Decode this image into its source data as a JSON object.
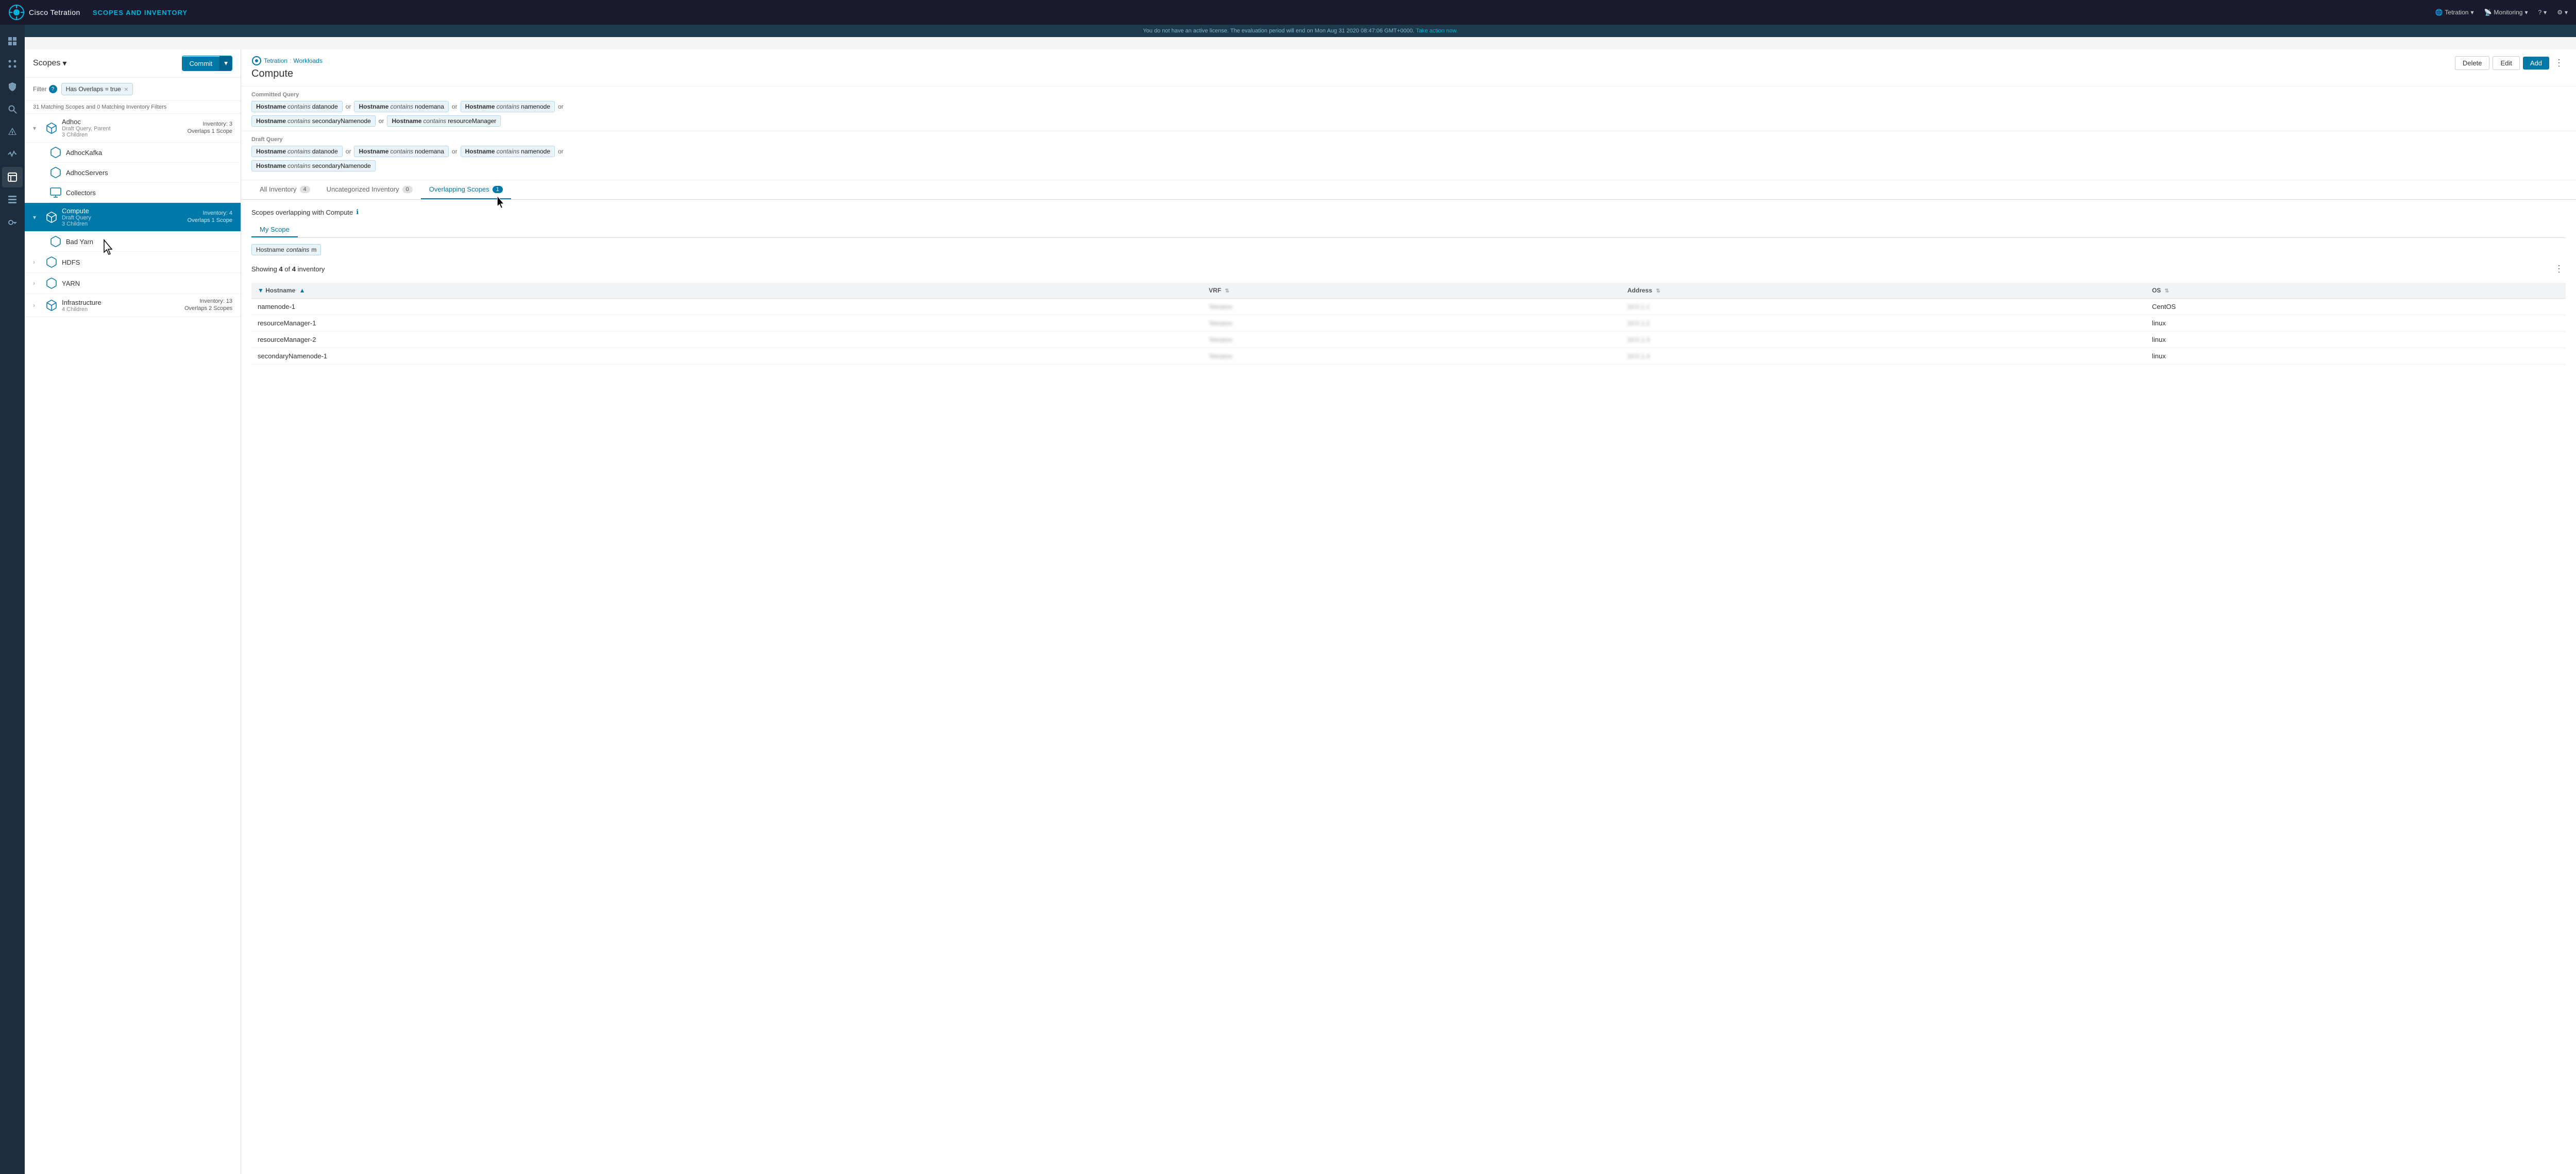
{
  "app": {
    "logo_text": "Cisco Tetration",
    "page_title": "SCOPES AND INVENTORY"
  },
  "top_nav": {
    "right_items": [
      {
        "label": "Tetration",
        "icon": "globe-icon",
        "has_dropdown": true
      },
      {
        "label": "Monitoring",
        "icon": "monitor-icon",
        "has_dropdown": true
      },
      {
        "label": "?",
        "icon": "help-icon",
        "has_dropdown": true
      },
      {
        "label": "⚙",
        "icon": "settings-icon",
        "has_dropdown": true
      }
    ]
  },
  "license_bar": {
    "text": "You do not have an active license. The evaluation period will end on Mon Aug 31 2020 08:47:06 GMT+0000.",
    "link_text": "Take action now."
  },
  "sidebar_icons": [
    {
      "icon": "chart-icon",
      "name": "dashboard"
    },
    {
      "icon": "grid-icon",
      "name": "apps"
    },
    {
      "icon": "shield-icon",
      "name": "security"
    },
    {
      "icon": "search-icon",
      "name": "search"
    },
    {
      "icon": "bell-icon",
      "name": "alerts"
    },
    {
      "icon": "activity-icon",
      "name": "activity"
    },
    {
      "icon": "layers-icon",
      "name": "scopes"
    },
    {
      "icon": "list-icon",
      "name": "inventory"
    },
    {
      "icon": "key-icon",
      "name": "keys"
    }
  ],
  "scopes_panel": {
    "title": "Scopes",
    "commit_button": "Commit",
    "filter_label": "Filter",
    "filter_tag": "Has Overlaps = true",
    "matching_text": "31 Matching Scopes and 0 Matching Inventory Filters",
    "items": [
      {
        "name": "Adhoc",
        "subtitle": "Draft Query, Parent",
        "children_count": "3 Children",
        "inventory": "Inventory: 3",
        "overlaps": "Overlaps 1 Scope",
        "expanded": true,
        "children": [
          {
            "name": "AdhocKafka",
            "has_icon": true
          },
          {
            "name": "AdhocServers",
            "has_icon": true
          },
          {
            "name": "Collectors",
            "has_icon": true
          }
        ]
      },
      {
        "name": "Compute",
        "subtitle": "Draft Query",
        "children_count": "3 Children",
        "inventory": "Inventory: 4",
        "overlaps": "Overlaps 1 Scope",
        "active": true,
        "expanded": true,
        "children": [
          {
            "name": "Bad Yarn",
            "has_icon": true
          }
        ]
      },
      {
        "name": "HDFS",
        "subtitle": "",
        "children_count": "",
        "inventory": "",
        "overlaps": "",
        "has_expand": true
      },
      {
        "name": "YARN",
        "subtitle": "",
        "children_count": "",
        "inventory": "",
        "overlaps": "",
        "has_expand": true
      },
      {
        "name": "Infrastructure",
        "subtitle": "",
        "children_count": "4 Children",
        "inventory": "Inventory: 13",
        "overlaps": "Overlaps 2 Scopes",
        "has_expand": true
      }
    ]
  },
  "content": {
    "breadcrumb_root": "Tetration",
    "breadcrumb_sep": ":",
    "breadcrumb_child": "Workloads",
    "scope_name": "Compute",
    "committed_query_label": "Committed Query",
    "committed_query": [
      [
        {
          "attr": "Hostname",
          "op": "contains",
          "val": "datanode"
        },
        "or",
        {
          "attr": "Hostname",
          "op": "contains",
          "val": "nodemana"
        },
        "or",
        {
          "attr": "Hostname",
          "op": "contains",
          "val": "namenode"
        },
        "or"
      ],
      [
        {
          "attr": "Hostname",
          "op": "contains",
          "val": "secondaryNamenode"
        },
        "or",
        {
          "attr": "Hostname",
          "op": "contains",
          "val": "resourceManager"
        }
      ]
    ],
    "draft_query_label": "Draft Query",
    "draft_query": [
      [
        {
          "attr": "Hostname",
          "op": "contains",
          "val": "datanode"
        },
        "or",
        {
          "attr": "Hostname",
          "op": "contains",
          "val": "nodemana"
        },
        "or",
        {
          "attr": "Hostname",
          "op": "contains",
          "val": "namenode"
        },
        "or"
      ],
      [
        {
          "attr": "Hostname",
          "op": "contains",
          "val": "secondaryNamenode"
        }
      ]
    ],
    "action_buttons": {
      "delete": "Delete",
      "edit": "Edit",
      "add": "Add"
    },
    "tabs": [
      {
        "label": "All Inventory",
        "count": "4",
        "id": "all"
      },
      {
        "label": "Uncategorized Inventory",
        "count": "0",
        "id": "uncategorized"
      },
      {
        "label": "Overlapping Scopes",
        "count": "1",
        "id": "overlapping",
        "active": true
      }
    ],
    "overlapping": {
      "section_title": "Scopes overlapping with Compute",
      "sub_tabs": [
        {
          "label": "My Scope",
          "active": true
        }
      ],
      "filter_tag_attr": "Hostname",
      "filter_tag_op": "contains",
      "filter_tag_val": "m",
      "showing_text": "Showing",
      "showing_count": "4",
      "showing_of": "of",
      "showing_total": "4",
      "showing_unit": "inventory",
      "table_columns": [
        {
          "label": "Hostname",
          "sortable": true,
          "filterable": true
        },
        {
          "label": "VRF",
          "sortable": true
        },
        {
          "label": "Address",
          "sortable": true
        },
        {
          "label": "OS",
          "sortable": true
        }
      ],
      "table_rows": [
        {
          "hostname": "namenode-1",
          "vrf": "Tetration",
          "address": "10.0.1.1",
          "os": "CentOS"
        },
        {
          "hostname": "resourceManager-1",
          "vrf": "Tetration",
          "address": "10.0.1.2",
          "os": "linux"
        },
        {
          "hostname": "resourceManager-2",
          "vrf": "Tetration",
          "address": "10.0.1.3",
          "os": "linux"
        },
        {
          "hostname": "secondaryNamenode-1",
          "vrf": "Tetration",
          "address": "10.0.1.4",
          "os": "linux"
        }
      ]
    }
  }
}
